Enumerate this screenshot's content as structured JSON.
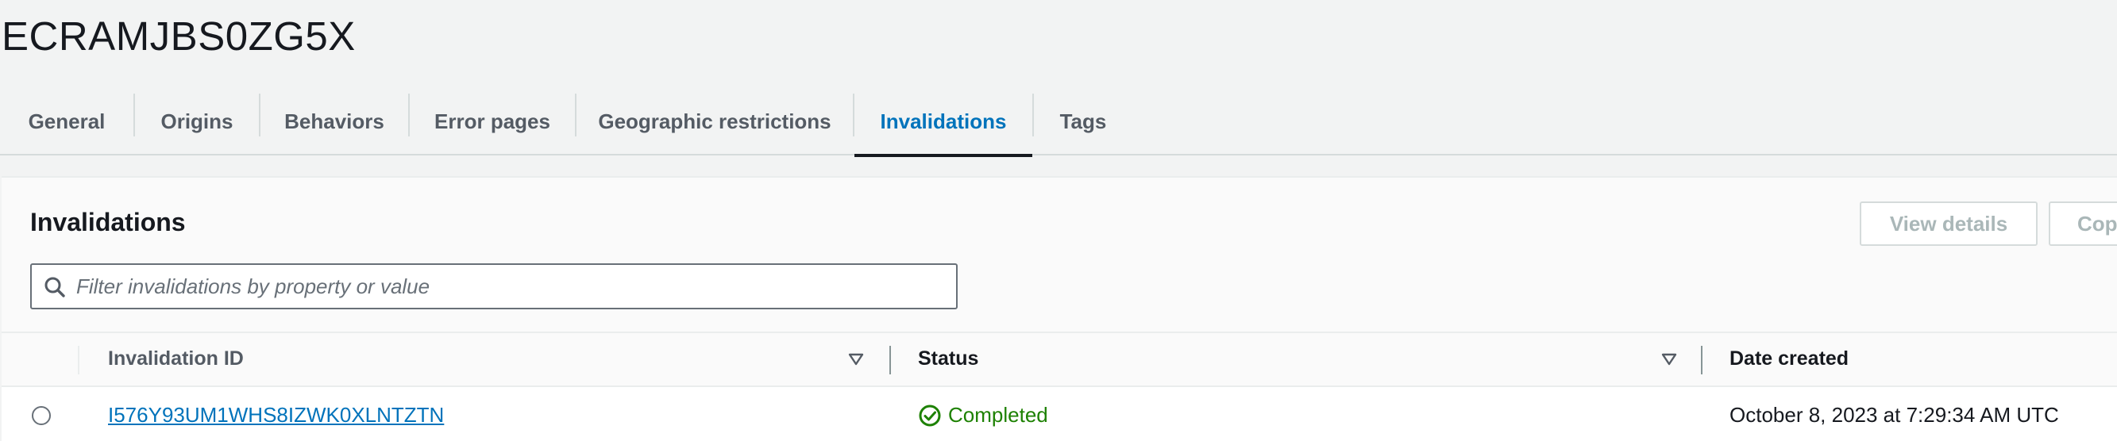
{
  "page": {
    "title": "ECRAMJBS0ZG5X"
  },
  "tabs": [
    {
      "label": "General",
      "active": false
    },
    {
      "label": "Origins",
      "active": false
    },
    {
      "label": "Behaviors",
      "active": false
    },
    {
      "label": "Error pages",
      "active": false
    },
    {
      "label": "Geographic restrictions",
      "active": false
    },
    {
      "label": "Invalidations",
      "active": true
    },
    {
      "label": "Tags",
      "active": false
    }
  ],
  "invalidations": {
    "title": "Invalidations",
    "actions": {
      "view_details_label": "View details",
      "copy_label": "Cop"
    },
    "search": {
      "placeholder": "Filter invalidations by property or value",
      "value": ""
    },
    "table": {
      "columns": [
        "Invalidation ID",
        "Status",
        "Date created"
      ],
      "rows": [
        {
          "id": "I576Y93UM1WHS8IZWK0XLNTZTN",
          "status": "Completed",
          "date_created": "October 8, 2023 at 7:29:34 AM UTC"
        }
      ]
    }
  },
  "colors": {
    "accent": "#0073bb",
    "success": "#1d8102",
    "disabled_text": "#aab7b8",
    "background": "#f2f3f3"
  },
  "icons": {
    "search": "search-icon",
    "sort": "sort-down-icon",
    "status": "status-success-icon"
  }
}
